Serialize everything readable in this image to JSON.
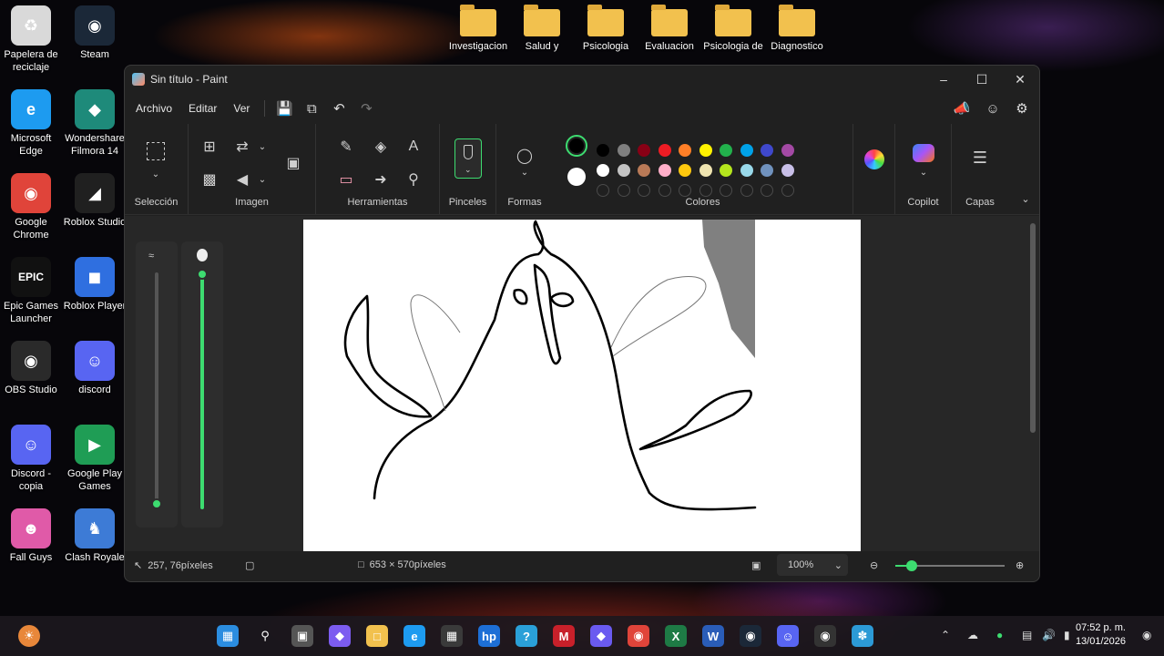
{
  "desktop": {
    "left_icons": [
      {
        "label": "Papelera de reciclaje",
        "icon": "recycle-bin-icon",
        "color": "#d9d9d9"
      },
      {
        "label": "Steam",
        "icon": "steam-icon",
        "color": "#1b2838"
      },
      {
        "label": "Microsoft Edge",
        "icon": "edge-icon",
        "color": "#1d9bf0"
      },
      {
        "label": "Wondershare Filmora 14",
        "icon": "filmora-icon",
        "color": "#1e8a7a"
      },
      {
        "label": "Google Chrome",
        "icon": "chrome-icon",
        "color": "#e0443a"
      },
      {
        "label": "Roblox Studio",
        "icon": "roblox-studio-icon",
        "color": "#202020"
      },
      {
        "label": "Epic Games Launcher",
        "icon": "epic-games-icon",
        "color": "#111111"
      },
      {
        "label": "Roblox Player",
        "icon": "roblox-player-icon",
        "color": "#2f6fe0"
      },
      {
        "label": "OBS Studio",
        "icon": "obs-icon",
        "color": "#2a2a2a"
      },
      {
        "label": "discord",
        "icon": "discord-icon",
        "color": "#5865f2"
      },
      {
        "label": "Discord - copia",
        "icon": "discord-icon",
        "color": "#5865f2"
      },
      {
        "label": "Google Play Games",
        "icon": "google-play-games-icon",
        "color": "#1f9d55"
      },
      {
        "label": "Fall Guys",
        "icon": "fall-guys-icon",
        "color": "#e05aa8"
      },
      {
        "label": "Clash Royale",
        "icon": "clash-royale-icon",
        "color": "#3d7bd6"
      }
    ],
    "folders": [
      {
        "label": "Investigacion"
      },
      {
        "label": "Salud y"
      },
      {
        "label": "Psicologia"
      },
      {
        "label": "Evaluacion"
      },
      {
        "label": "Psicologia de"
      },
      {
        "label": "Diagnostico"
      }
    ]
  },
  "paint": {
    "title": "Sin título - Paint",
    "menu": {
      "file": "Archivo",
      "edit": "Editar",
      "view": "Ver"
    },
    "groups": {
      "selection": "Selección",
      "image": "Imagen",
      "tools": "Herramientas",
      "brushes": "Pinceles",
      "shapes": "Formas",
      "colors": "Colores",
      "copilot": "Copilot",
      "layers": "Capas"
    },
    "colors": {
      "primary": "#000000",
      "secondary": "#ffffff",
      "row1": [
        "#000000",
        "#7f7f7f",
        "#880015",
        "#ed1c24",
        "#ff7f27",
        "#fff200",
        "#22b14c",
        "#00a2e8",
        "#3f48cc",
        "#a349a4"
      ],
      "row2": [
        "#ffffff",
        "#c3c3c3",
        "#b97a57",
        "#ffaec9",
        "#ffc90e",
        "#efe4b0",
        "#b5e61d",
        "#99d9ea",
        "#7092be",
        "#c8bfe7"
      ],
      "accent_green": "#3ddc70"
    },
    "status": {
      "cursor_pos": "257, 76píxeles",
      "canvas_size": "653 × 570píxeles",
      "zoom": "100%"
    }
  },
  "taskbar": {
    "clock_time": "07:52 p. m.",
    "clock_date": "13/01/2026",
    "apps": [
      {
        "icon": "start-icon"
      },
      {
        "icon": "search-icon"
      },
      {
        "icon": "task-view-icon"
      },
      {
        "icon": "copilot-icon"
      },
      {
        "icon": "file-explorer-icon"
      },
      {
        "icon": "edge-icon"
      },
      {
        "icon": "store-icon"
      },
      {
        "icon": "hp-icon"
      },
      {
        "icon": "help-icon"
      },
      {
        "icon": "mcafee-icon"
      },
      {
        "icon": "copilot-app-icon"
      },
      {
        "icon": "chrome-icon"
      },
      {
        "icon": "excel-icon"
      },
      {
        "icon": "word-icon"
      },
      {
        "icon": "steam-icon"
      },
      {
        "icon": "discord-icon"
      },
      {
        "icon": "obs-icon"
      },
      {
        "icon": "paint-icon"
      }
    ]
  }
}
